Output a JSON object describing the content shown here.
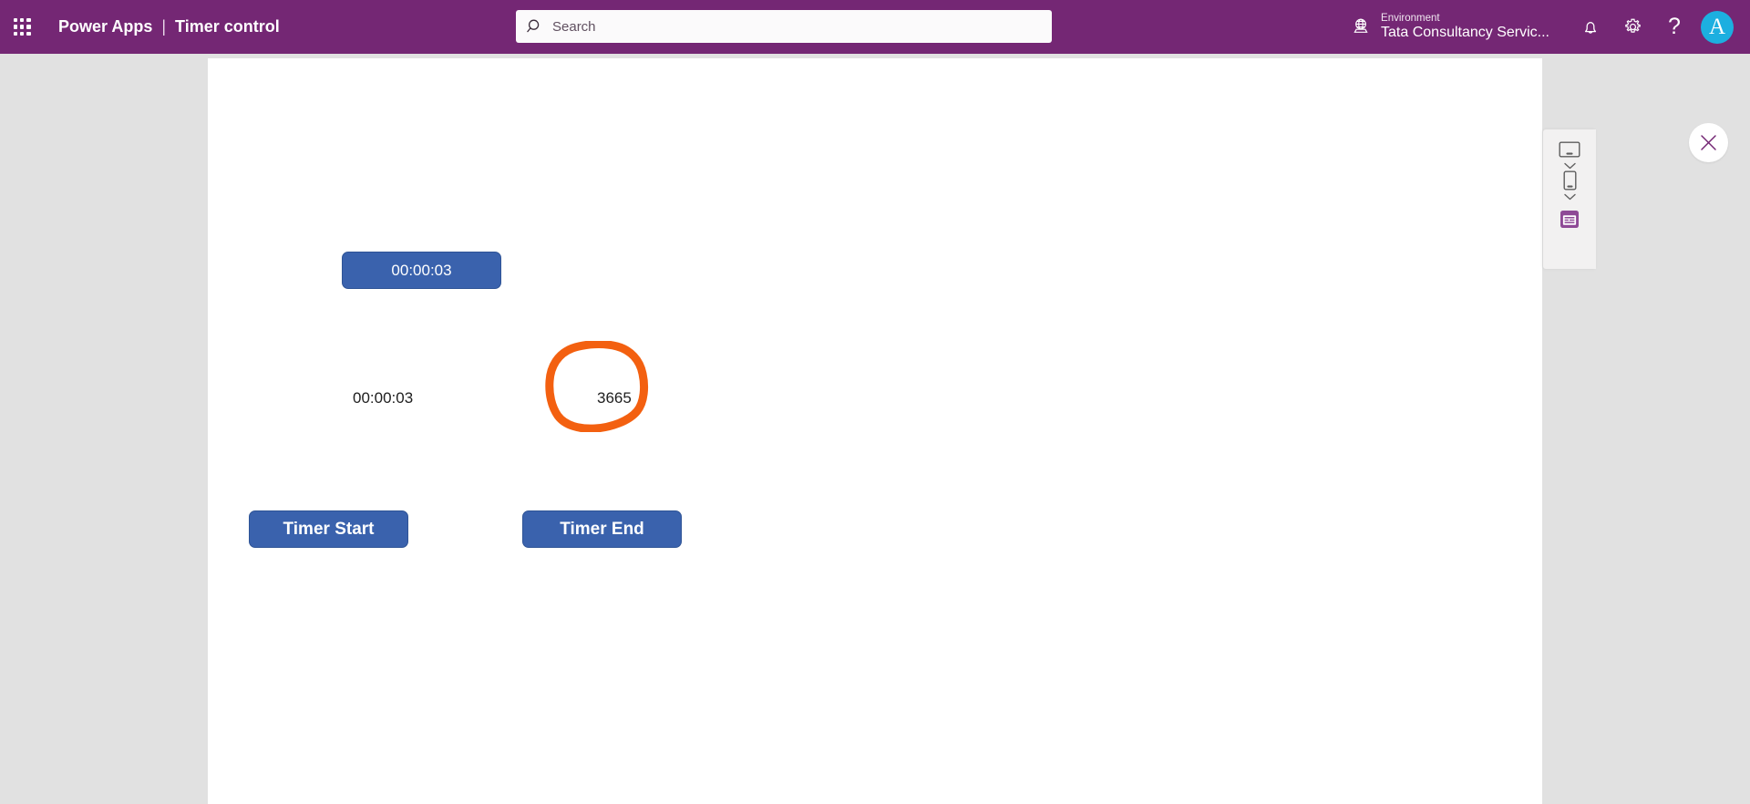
{
  "header": {
    "waffle_icon": "app-launcher-grid-icon",
    "product_name": "Power Apps",
    "separator": "|",
    "app_name": "Timer control",
    "search": {
      "icon": "search-icon",
      "placeholder": "Search",
      "value": ""
    },
    "environment": {
      "icon": "environment-globe-icon",
      "label": "Environment",
      "name": "Tata Consultancy Servic..."
    },
    "actions": [
      {
        "icon": "notification-bell-icon",
        "name": "notifications"
      },
      {
        "icon": "gear-icon",
        "name": "settings"
      },
      {
        "icon": "question-mark-icon",
        "name": "help",
        "glyph": "?"
      }
    ],
    "avatar": {
      "initial": "A",
      "color": "#1cafe0"
    },
    "bar_color": "#742774"
  },
  "close_button": {
    "icon": "close-icon",
    "label": "Close",
    "color": "#742774"
  },
  "canvas": {
    "background": "#ffffff",
    "controls": {
      "timer_display": {
        "label": "00:00:03",
        "fill": "#3a62ad",
        "text_color": "#ffffff"
      },
      "elapsed_label": "00:00:03",
      "seconds_label": "3665",
      "timer_start_button": {
        "label": "Timer Start",
        "fill": "#3a62ad"
      },
      "timer_end_button": {
        "label": "Timer End",
        "fill": "#3a62ad"
      }
    },
    "annotation": {
      "type": "hand-drawn-circle",
      "color": "#f36010",
      "targets": "3665"
    }
  },
  "device_panel": {
    "items": [
      {
        "icon": "tablet-landscape-icon",
        "name": "tablet-preview",
        "has_chevron": true
      },
      {
        "icon": "phone-portrait-icon",
        "name": "phone-preview",
        "has_chevron": true
      },
      {
        "icon": "app-layout-icon",
        "name": "app-layout-preview",
        "active": true,
        "color": "#8e4a96"
      }
    ],
    "chevron_icon": "chevron-down-icon",
    "background": "#f2f1f1"
  },
  "stage": {
    "background": "#e1e1e1"
  }
}
